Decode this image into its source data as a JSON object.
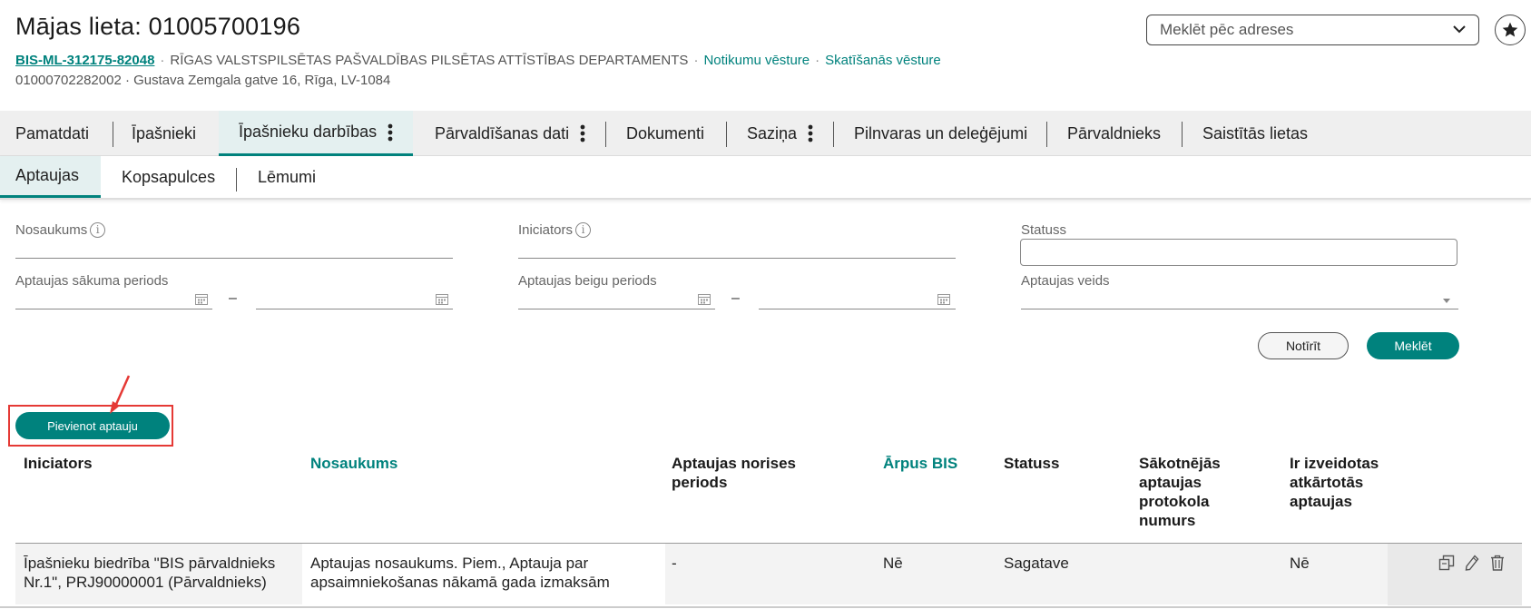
{
  "header": {
    "title": "Mājas lieta: 01005700196",
    "code": "BIS-ML-312175-82048",
    "department": "RĪGAS VALSTSPILSĒTAS PAŠVALDĪBAS PILSĒTAS ATTĪSTĪBAS DEPARTAMENTS",
    "link_events": "Notikumu vēsture",
    "link_views": "Skatīšanās vēsture",
    "address_line": "01000702282002 · Gustava Zemgala gatve 16, Rīga, LV-1084",
    "address_search_placeholder": "Meklēt pēc adreses"
  },
  "main_tabs": [
    {
      "label": "Pamatdati"
    },
    {
      "label": "Īpašnieki"
    },
    {
      "label": "Īpašnieku darbības",
      "active": true
    },
    {
      "label": "Pārvaldīšanas dati"
    },
    {
      "label": "Dokumenti"
    },
    {
      "label": "Saziņa"
    },
    {
      "label": "Pilnvaras un deleģējumi"
    },
    {
      "label": "Pārvaldnieks"
    },
    {
      "label": "Saistītās lietas"
    }
  ],
  "sub_tabs": [
    {
      "label": "Aptaujas",
      "active": true
    },
    {
      "label": "Kopsapulces"
    },
    {
      "label": "Lēmumi"
    }
  ],
  "filters": {
    "name_label": "Nosaukums",
    "initiator_label": "Iniciators",
    "status_label": "Statuss",
    "start_period_label": "Aptaujas sākuma periods",
    "end_period_label": "Aptaujas beigu periods",
    "type_label": "Aptaujas veids",
    "range_dash": "–",
    "info_glyph": "i",
    "clear_button": "Notīrīt",
    "search_button": "Meklēt"
  },
  "add_button": "Pievienot aptauju",
  "table": {
    "headers": {
      "initiator": "Iniciators",
      "name": "Nosaukums",
      "period": "Aptaujas norises periods",
      "outside_bis": "Ārpus BIS",
      "status": "Statuss",
      "protocol": "Sākotnējās aptaujas protokola numurs",
      "repeat": "Ir izveidotas atkārtotās aptaujas"
    },
    "rows": [
      {
        "initiator": "Īpašnieku biedrība \"BIS pārvaldnieks Nr.1\", PRJ90000001 (Pārvaldnieks)",
        "name": "Aptaujas nosaukums. Piem., Aptauja par apsaimniekošanas nākamā gada izmaksām",
        "period": "-",
        "outside_bis": "Nē",
        "status": "Sagatave",
        "protocol": "",
        "repeat": "Nē"
      }
    ]
  },
  "colors": {
    "accent": "#00827d",
    "highlight": "#e53935"
  }
}
